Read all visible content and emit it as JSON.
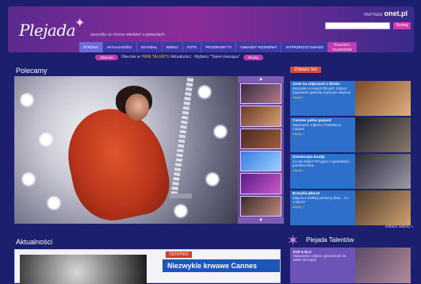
{
  "header": {
    "logo": "Plejada",
    "tagline": "wszystko co chcesz wiedzieć o gwiazdach",
    "partner_label": "PARTNER",
    "partner_brand": "onet.pl",
    "search_button": "Szukaj",
    "nav": [
      "STRONA",
      "AKTUALNOŚCI",
      "SKANDAL",
      "WIDEO",
      "FOTO",
      "PROGRAMY TV",
      "GWIAZDY ROZMOWY",
      "WYPRZEDAŻ GWIAZD",
      "PLEJADA\nTALENTÓW"
    ]
  },
  "strip": {
    "pill_left": "Obecnie",
    "text": "Obecnie w: ",
    "highlight": "PANI TALENTU",
    "tail": "Aktualności · Wybierz \"Talent miesiąca\"",
    "pill_right": "Głosuj"
  },
  "polecamy": {
    "title": "Polecamy",
    "arrow_up": "▲",
    "arrow_down": "▼"
  },
  "zobacz": {
    "badge": "Zobacz też",
    "items": [
      {
        "title": "Szok na zdjęciach z bliska",
        "text": "Wszystko o nowych filmach. Zobacz najnowsze gwiazdy w jednym miejscu!",
        "more": "więcej »"
      },
      {
        "title": "Cannes pełne gwiazd",
        "text": "Najnowsze zdjęcia z festiwalu w Cannes",
        "more": "więcej »"
      },
      {
        "title": "Dziewczęta kusiły",
        "text": "Co się działo? Przyjęcie z gwiazdami i premiera filmu",
        "more": "więcej »"
      },
      {
        "title": "Brazylia płacze",
        "text": "Zdjęcia z wielkiej premiery filmu... Co zrobisz?",
        "more": "więcej »"
      }
    ],
    "link": "zobacz więcej »"
  },
  "aktualnosci": {
    "title": "Aktualności",
    "badge": "OSTATNIO",
    "headline": "Niezwykle krwawe Cannes"
  },
  "talenty": {
    "title": "Plejada Talentów",
    "name": "EVE & ELA",
    "text": "Najnowsze zdjęcia i głosowanie na talent miesiąca"
  }
}
